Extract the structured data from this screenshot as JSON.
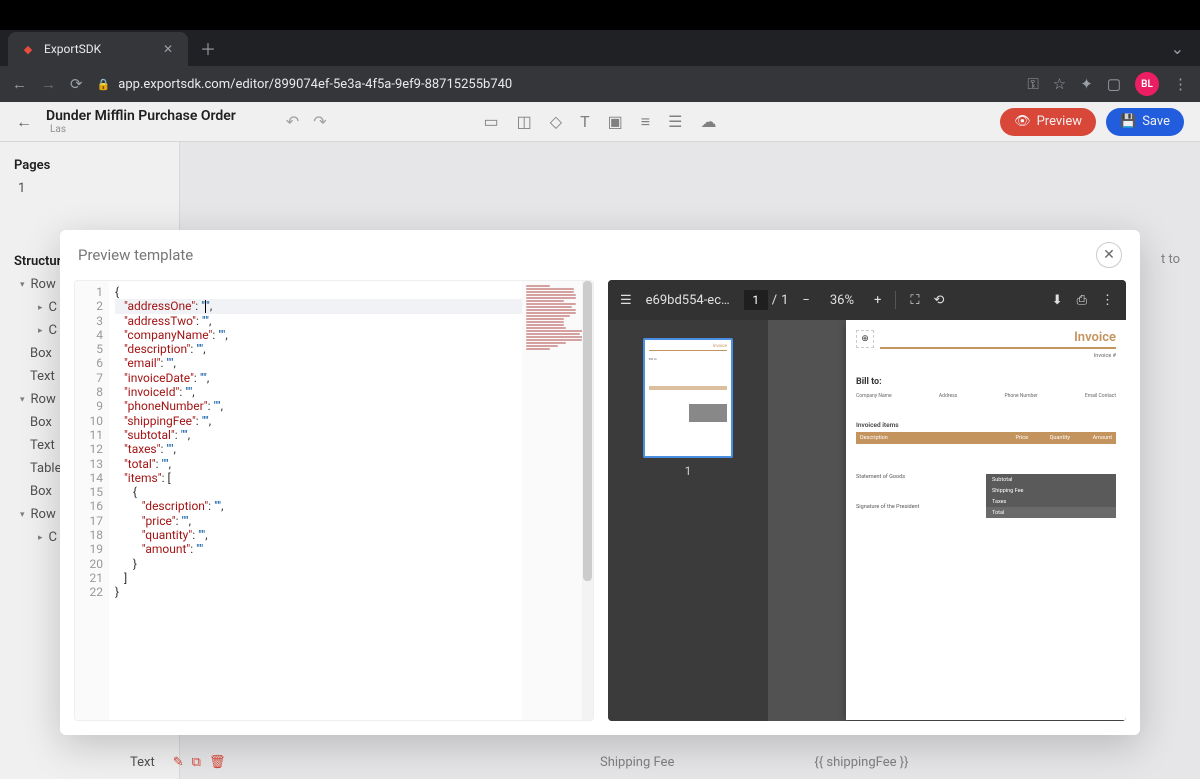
{
  "browser": {
    "tab_title": "ExportSDK",
    "url": "app.exportsdk.com/editor/899074ef-5e3a-4f5a-9ef9-88715255b740",
    "avatar_initials": "BL"
  },
  "app": {
    "document_title": "Dunder Mifflin Purchase Order",
    "last_saved_prefix": "Las",
    "preview_button": "Preview",
    "save_button": "Save",
    "right_bg_text": "t to"
  },
  "sidebar": {
    "pages_heading": "Pages",
    "page_number": "1",
    "structure_heading": "Structure",
    "items": [
      "Row",
      "C",
      "C",
      "Box",
      "Text",
      "Row",
      "Box",
      "Text",
      "Table",
      "Box",
      "Row",
      "C"
    ],
    "bottom_text": "Text"
  },
  "bottom": {
    "label": "Shipping Fee",
    "value": "{{ shippingFee }}"
  },
  "modal": {
    "title": "Preview template"
  },
  "code": {
    "lines": [
      {
        "num": 1,
        "indent": 0,
        "text": "{",
        "type": "brace"
      },
      {
        "num": 2,
        "indent": 1,
        "key": "addressOne",
        "val": "",
        "caret": true,
        "trail": ","
      },
      {
        "num": 3,
        "indent": 1,
        "key": "addressTwo",
        "val": "",
        "trail": ","
      },
      {
        "num": 4,
        "indent": 1,
        "key": "companyName",
        "val": "",
        "trail": ","
      },
      {
        "num": 5,
        "indent": 1,
        "key": "description",
        "val": "",
        "trail": ","
      },
      {
        "num": 6,
        "indent": 1,
        "key": "email",
        "val": "",
        "trail": ","
      },
      {
        "num": 7,
        "indent": 1,
        "key": "invoiceDate",
        "val": "",
        "trail": ","
      },
      {
        "num": 8,
        "indent": 1,
        "key": "invoiceId",
        "val": "",
        "trail": ","
      },
      {
        "num": 9,
        "indent": 1,
        "key": "phoneNumber",
        "val": "",
        "trail": ","
      },
      {
        "num": 10,
        "indent": 1,
        "key": "shippingFee",
        "val": "",
        "trail": ","
      },
      {
        "num": 11,
        "indent": 1,
        "key": "subtotal",
        "val": "",
        "trail": ","
      },
      {
        "num": 12,
        "indent": 1,
        "key": "taxes",
        "val": "",
        "trail": ","
      },
      {
        "num": 13,
        "indent": 1,
        "key": "total",
        "val": "",
        "trail": ","
      },
      {
        "num": 14,
        "indent": 1,
        "key": "items",
        "raw": "[",
        "trail": ""
      },
      {
        "num": 15,
        "indent": 2,
        "text": "{",
        "type": "brace"
      },
      {
        "num": 16,
        "indent": 3,
        "key": "description",
        "val": "",
        "trail": ","
      },
      {
        "num": 17,
        "indent": 3,
        "key": "price",
        "val": "",
        "trail": ","
      },
      {
        "num": 18,
        "indent": 3,
        "key": "quantity",
        "val": "",
        "trail": ","
      },
      {
        "num": 19,
        "indent": 3,
        "key": "amount",
        "val": "",
        "trail": ""
      },
      {
        "num": 20,
        "indent": 2,
        "text": "}",
        "type": "brace"
      },
      {
        "num": 21,
        "indent": 1,
        "text": "]",
        "type": "brace"
      },
      {
        "num": 22,
        "indent": 0,
        "text": "}",
        "type": "brace"
      }
    ]
  },
  "pdf": {
    "filename": "e69bd554-ec…",
    "page_current": "1",
    "page_total": "1",
    "zoom": "36%",
    "thumb_number": "1"
  },
  "invoice": {
    "title": "Invoice",
    "invoice_no_label": "Invoice #",
    "bill_to": "Bill to:",
    "labels": [
      "Company Name",
      "Address",
      "Phone Number",
      "Email Contact"
    ],
    "section_label": "Invoiced items",
    "columns": [
      "Description",
      "Price",
      "Quantity",
      "Amount"
    ],
    "statement": "Statement of Goods",
    "signature": "Signature of the President",
    "totals": [
      "Subtotal",
      "Shipping Fee",
      "Taxes",
      "Total"
    ]
  }
}
